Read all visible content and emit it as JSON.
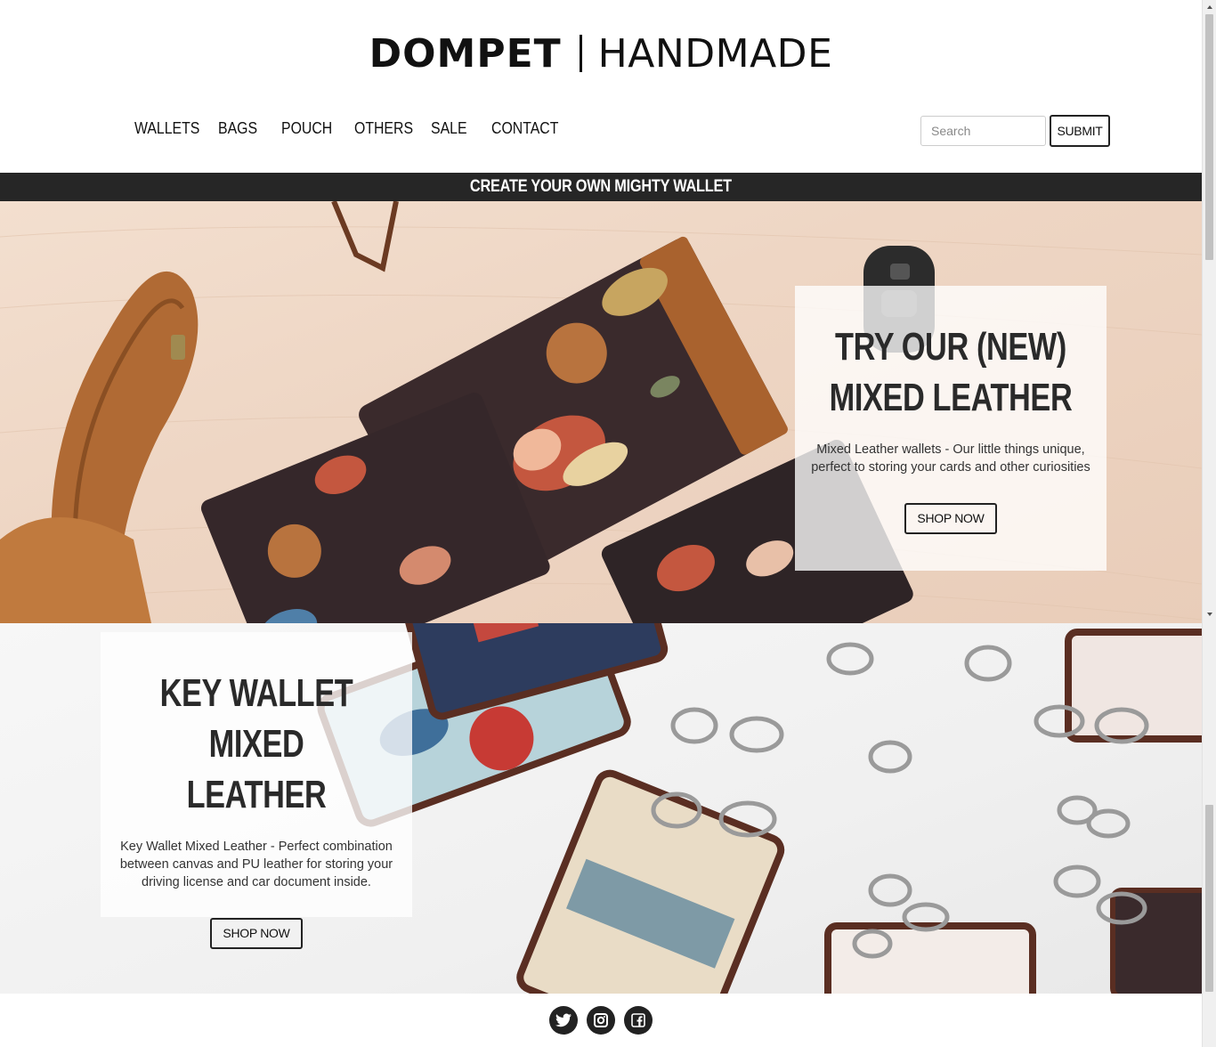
{
  "logo": {
    "brand": "DOMPET",
    "sub": "HANDMADE"
  },
  "nav": {
    "items": [
      {
        "label": "WALLETS"
      },
      {
        "label": "BAGS"
      },
      {
        "label": "POUCH"
      },
      {
        "label": "OTHERS"
      },
      {
        "label": "SALE"
      },
      {
        "label": "CONTACT"
      }
    ]
  },
  "search": {
    "placeholder": "Search",
    "value": "",
    "submit_label": "SUBMIT"
  },
  "banner": {
    "text": "CREATE YOUR OWN MIGHTY WALLET"
  },
  "hero1": {
    "title": "TRY OUR (NEW)\nMIXED LEATHER",
    "text": "Mixed Leather wallets - Our little things unique, perfect to storing your cards and other curiosities",
    "button": "SHOP NOW"
  },
  "hero2": {
    "title": "KEY WALLET MIXED\nLEATHER",
    "text": "Key Wallet Mixed Leather - Perfect combination between canvas and PU leather for storing your driving license and car document inside.",
    "button": "SHOP NOW"
  },
  "footer": {
    "icons": [
      "twitter-icon",
      "instagram-icon",
      "facebook-icon"
    ]
  },
  "colors": {
    "banner_bg": "#262626",
    "text": "#222222",
    "social_bg": "#222222"
  }
}
